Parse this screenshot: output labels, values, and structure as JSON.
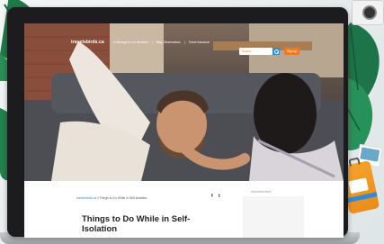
{
  "site": {
    "logo": "travelsbirds.ca",
    "nav_links": [
      "A Message to our Members",
      "Blog: Observations",
      "Travel Insurance"
    ],
    "search_placeholder": "Search",
    "signup_label": "Sign up"
  },
  "article": {
    "breadcrumb_home": "travelsbirds.ca",
    "breadcrumb_sep": "»",
    "breadcrumb_current": "Things to Do While in Self-Isolation",
    "title": "Things to Do While in Self-Isolation",
    "share_facebook": "f",
    "share_twitter": "t"
  },
  "sidebar": {
    "ad_label": "Advertisement"
  },
  "colors": {
    "accent_orange": "#f07a1f",
    "accent_blue": "#2e8bd8"
  }
}
